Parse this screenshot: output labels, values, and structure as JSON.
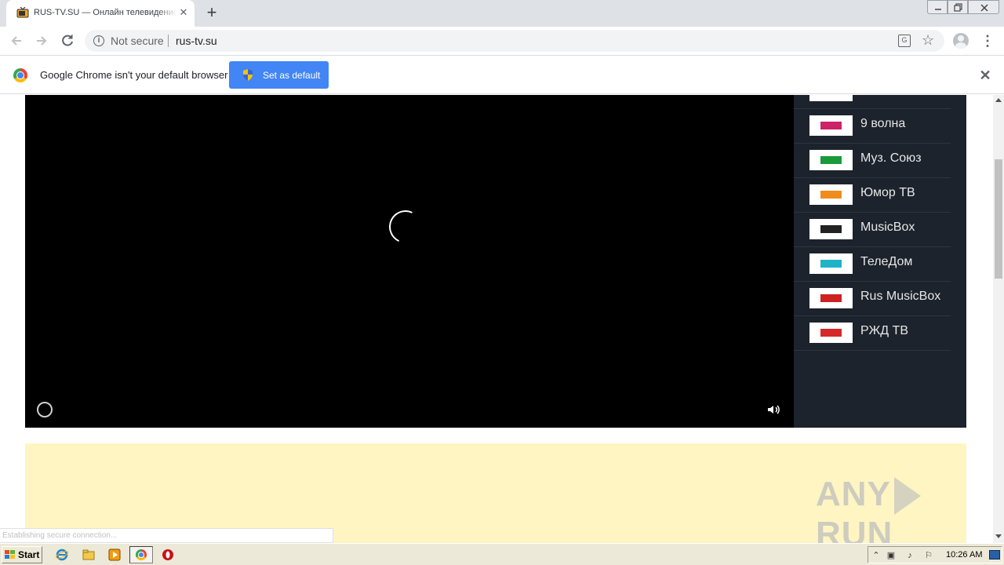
{
  "browser": {
    "tab": {
      "title": "RUS-TV.SU — Онлайн телевидение"
    },
    "address_bar": {
      "security_label": "Not secure",
      "url": "rus-tv.su"
    },
    "infobar": {
      "message": "Google Chrome isn't your default browser",
      "button_label": "Set as default"
    }
  },
  "player": {
    "channels": [
      {
        "name": "9 волна",
        "logo_color": "#cc2266"
      },
      {
        "name": "Муз. Союз",
        "logo_color": "#1a9a3a"
      },
      {
        "name": "Юмор ТВ",
        "logo_color": "#f08c1e"
      },
      {
        "name": "MusicBox",
        "logo_color": "#222222"
      },
      {
        "name": "ТелеДом",
        "logo_color": "#1fb3c8"
      },
      {
        "name": "Rus MusicBox",
        "logo_color": "#cc2222"
      },
      {
        "name": "РЖД ТВ",
        "logo_color": "#d62828"
      }
    ]
  },
  "page": {
    "status_text": "Establishing secure connection...",
    "watermark_left": "ANY",
    "watermark_right": "RUN"
  },
  "taskbar": {
    "start_label": "Start",
    "clock": "10:26 AM"
  },
  "colors": {
    "video_background": "#000000",
    "channel_panel": "#1c232c",
    "yellow_area": "#fef5c2",
    "infobar_button": "#4285f4"
  }
}
